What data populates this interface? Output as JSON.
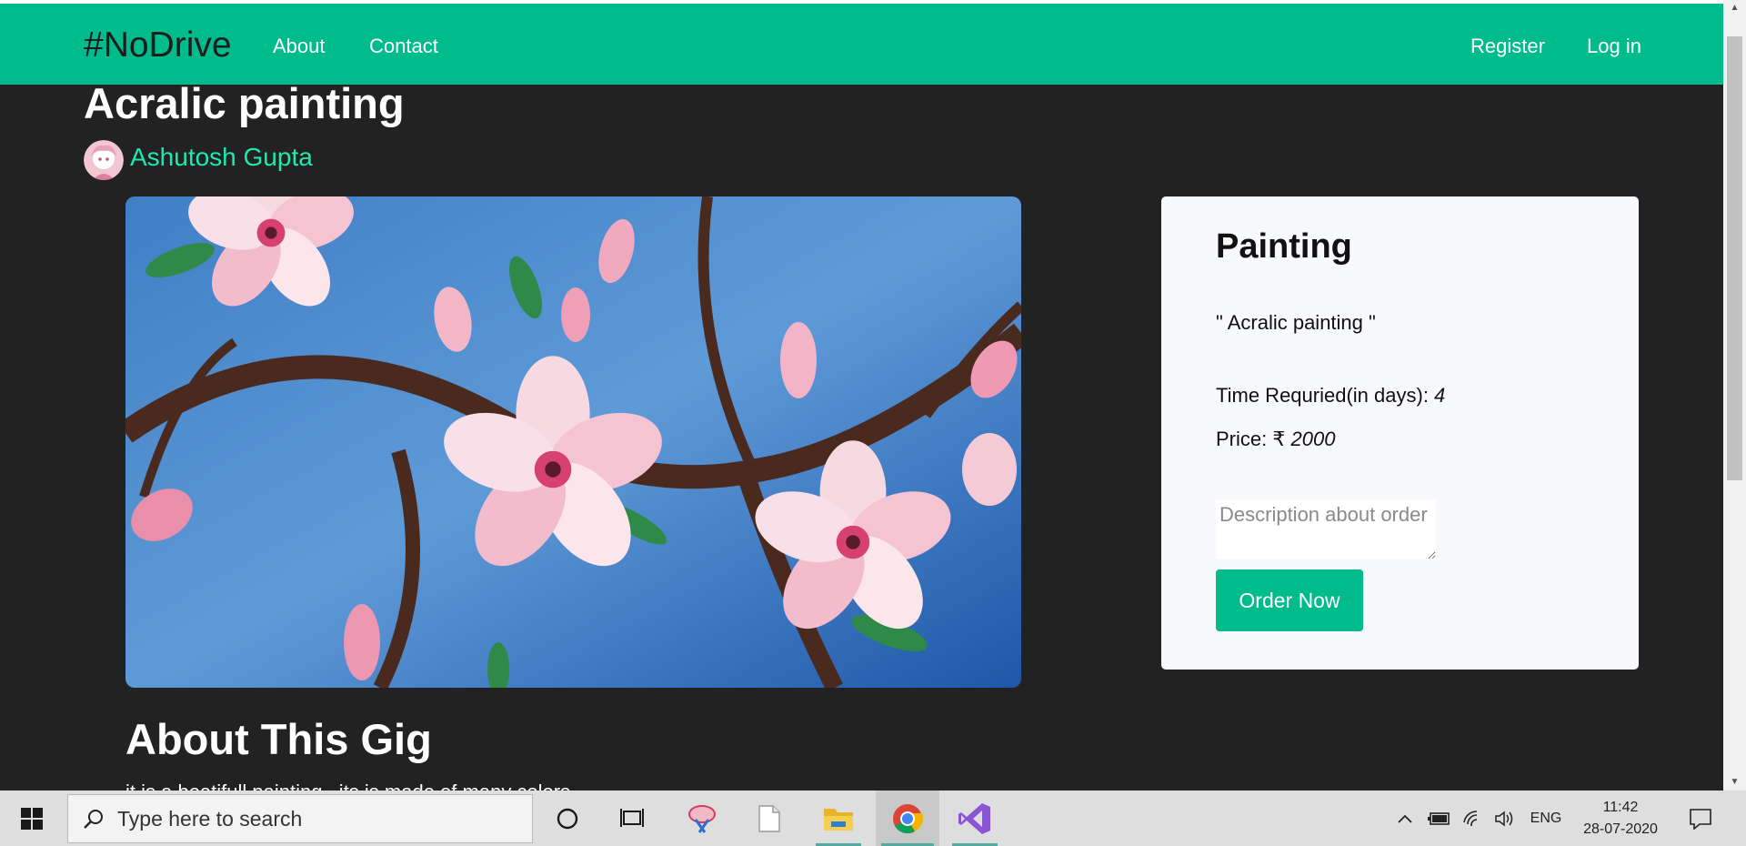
{
  "navbar": {
    "brand": "#NoDrive",
    "links": [
      "About",
      "Contact"
    ],
    "right_links": [
      "Register",
      "Log in"
    ]
  },
  "gig": {
    "title": "Acralic painting",
    "seller": "Ashutosh Gupta"
  },
  "order_card": {
    "category": "Painting",
    "quote": "\" Acralic painting \"",
    "time_label": "Time Requried(in days): ",
    "time_value": "4",
    "price_label": "Price: ",
    "currency": "₹",
    "price_value": "2000",
    "description_placeholder": "Description about order",
    "order_button": "Order Now"
  },
  "about": {
    "heading": "About This Gig",
    "text": "it is a beatifull painting , its is made of many colors"
  },
  "taskbar": {
    "search_placeholder": "Type here to search",
    "language": "ENG",
    "time": "11:42",
    "date": "28-07-2020"
  },
  "colors": {
    "accent": "#00bc8c",
    "seller_link": "#1de9b0",
    "page_bg": "#222222",
    "card_bg": "#f8f9fc"
  }
}
